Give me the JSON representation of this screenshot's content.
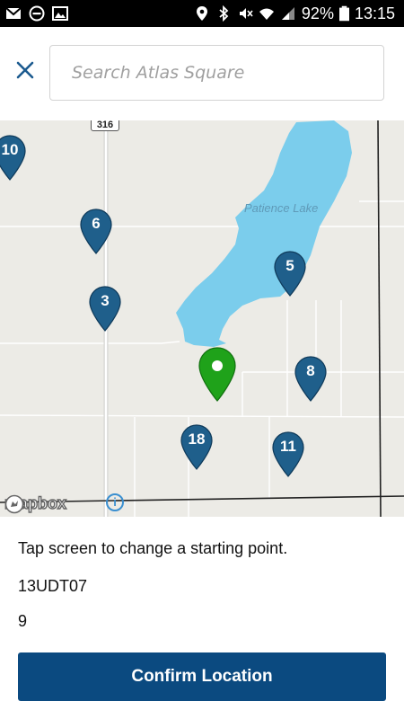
{
  "status_bar": {
    "battery": "92%",
    "time": "13:15"
  },
  "header": {
    "search_placeholder": "Search Atlas Square",
    "close_icon": "close-icon"
  },
  "map": {
    "road_label": "316",
    "lake_label": "Patience Lake",
    "attribution": "mapbox",
    "pin_color": "#1f5f8b",
    "selected_pin_color": "#1fa21a",
    "pins": [
      "10",
      "6",
      "5",
      "3",
      "8",
      "18",
      "11"
    ]
  },
  "panel": {
    "instruction": "Tap screen to change a starting point.",
    "square_code": "13UDT07",
    "count": "9",
    "confirm_label": "Confirm Location",
    "button_color": "#0b4a80"
  }
}
